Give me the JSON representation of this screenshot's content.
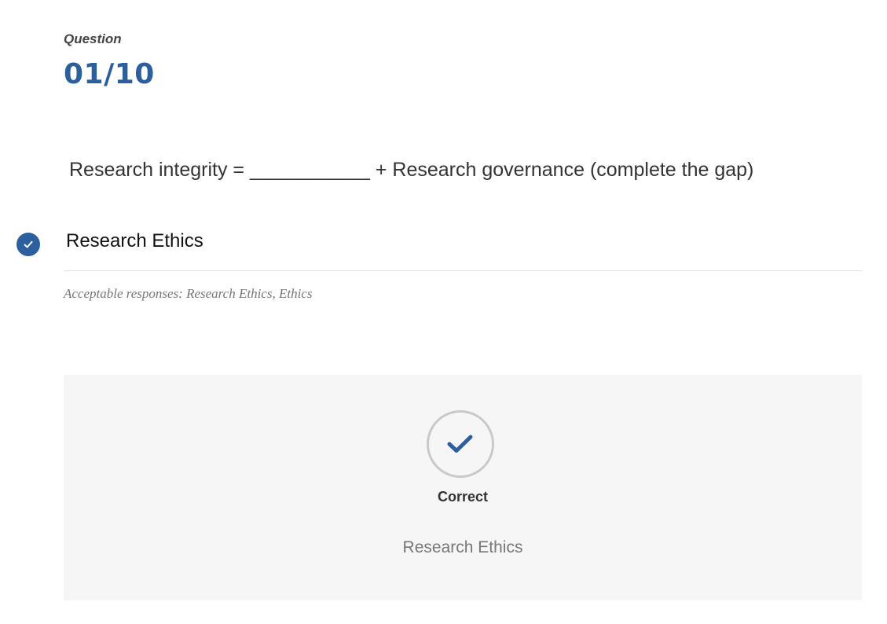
{
  "question": {
    "label": "Question",
    "number": "01/10",
    "prompt": "Research integrity = ___________ + Research governance (complete the gap)"
  },
  "answer": {
    "text": "Research Ethics",
    "check_icon": "check-circle-icon",
    "accent_color": "#2b5f9e"
  },
  "acceptable": {
    "text": "Acceptable responses: Research Ethics, Ethics"
  },
  "feedback": {
    "icon": "checkmark-icon",
    "status": "Correct",
    "answer": "Research Ethics"
  }
}
